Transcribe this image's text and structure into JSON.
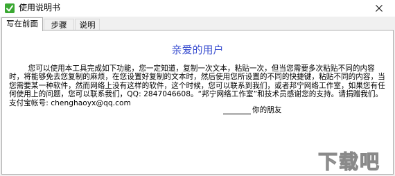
{
  "window": {
    "title": "使用说明书",
    "close_symbol": "✕"
  },
  "tabs": [
    {
      "label": "写在前面",
      "active": true
    },
    {
      "label": "步骤",
      "active": false
    },
    {
      "label": "说明",
      "active": false
    }
  ],
  "content": {
    "heading": "亲爱的用户",
    "paragraph": "您可以使用本工具完成如下功能，您一定知道，复制一次文本，粘贴一次，但当您需要多次粘贴不同的内容时，将能够免去您复制的麻烦，在您设置好复制的文本时，然后使用您所设置的不同的快捷键，粘贴不同的内容，当您需要某一种软件，然而网络上没有这样的软件，这个时候，您可以联系到我们，或者邦宁网络工作室，如果您有任何使用上的问题，您可以联系我们，QQ: 2847046608。“邦宁网络工作室”和技术员感谢您的支持。请捐赠我们。支付宝帐号: chenghaoyx@qq.com",
    "signature": "你的朋友"
  },
  "watermark": {
    "text": "下载吧"
  },
  "colors": {
    "heading": "#3b4fd0",
    "icon_green": "#3aa832"
  }
}
